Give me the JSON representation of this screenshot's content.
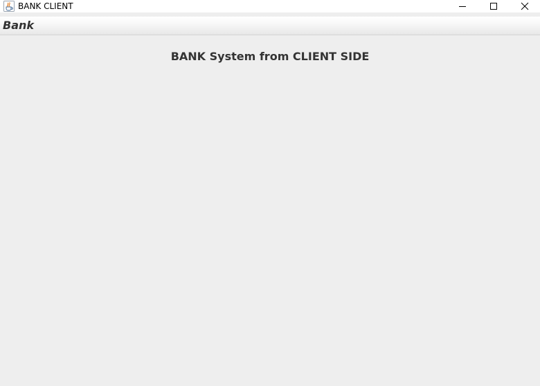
{
  "window": {
    "title": "BANK CLIENT",
    "icon": "java-cup-icon",
    "controls": [
      "minimize-icon",
      "maximize-icon",
      "close-icon"
    ]
  },
  "menubar": {
    "items": [
      {
        "label": "Bank"
      }
    ]
  },
  "main": {
    "heading": "BANK System from CLIENT SIDE"
  },
  "colors": {
    "background": "#eeeeee",
    "text": "#333333",
    "titlebar": "#ffffff"
  }
}
